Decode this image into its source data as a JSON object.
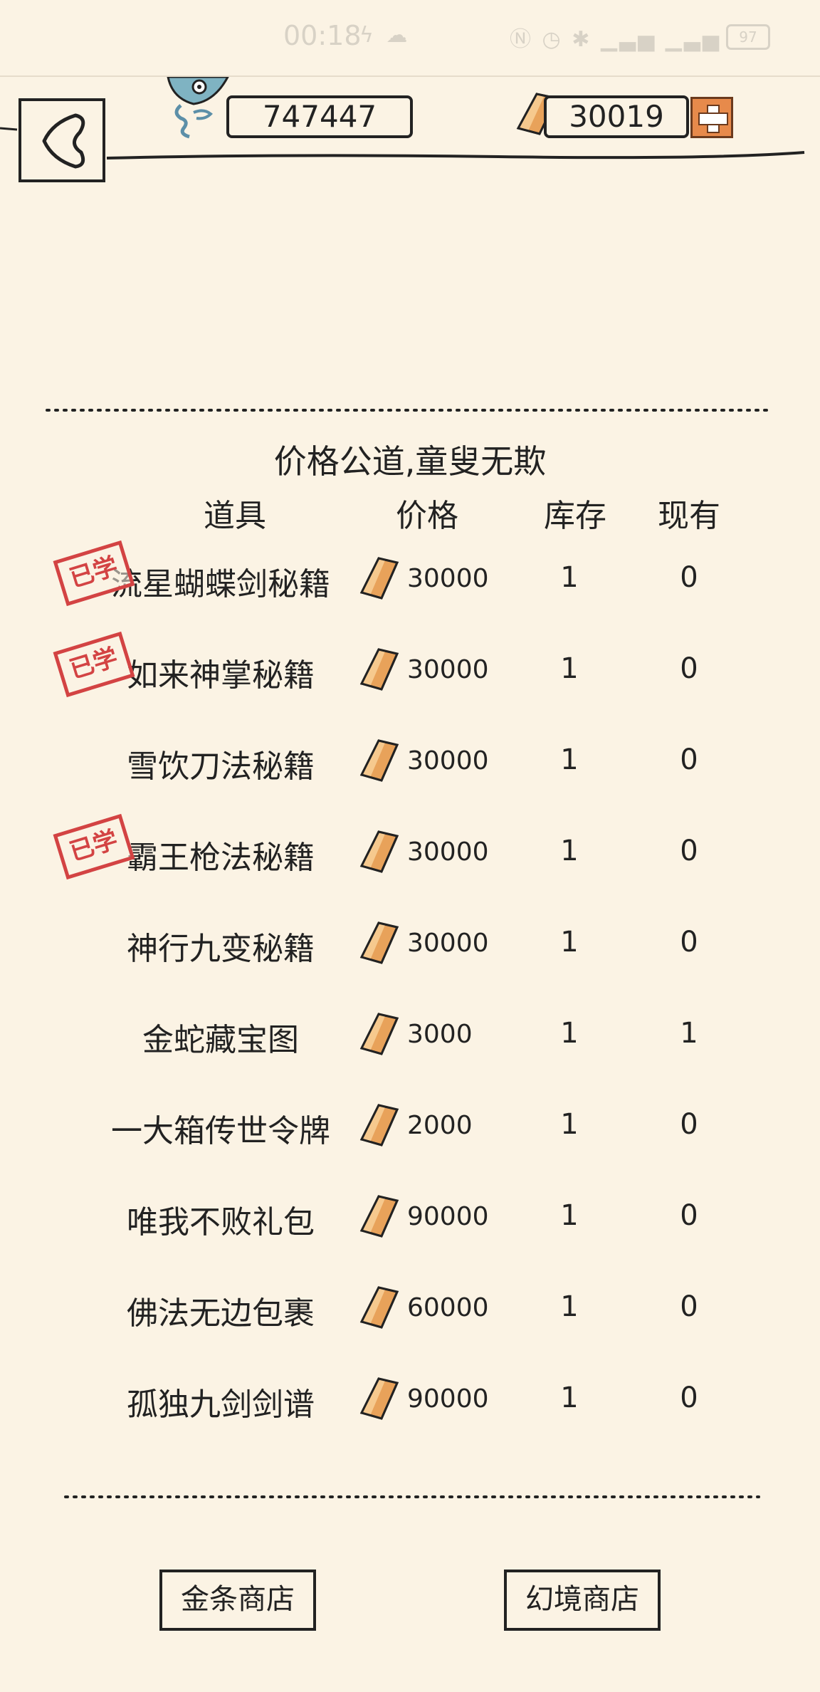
{
  "status_bar": {
    "time": "00:18",
    "battery": "97"
  },
  "header": {
    "coins": "747447",
    "gold": "30019"
  },
  "shop": {
    "slogan": "价格公道,童叟无欺",
    "columns": {
      "item": "道具",
      "price": "价格",
      "stock": "库存",
      "owned": "现有"
    },
    "stamp_text": "已学",
    "rows": [
      {
        "name": "流星蝴蝶剑秘籍",
        "price": "30000",
        "stock": "1",
        "owned": "0",
        "learned": true
      },
      {
        "name": "如来神掌秘籍",
        "price": "30000",
        "stock": "1",
        "owned": "0",
        "learned": true
      },
      {
        "name": "雪饮刀法秘籍",
        "price": "30000",
        "stock": "1",
        "owned": "0",
        "learned": false
      },
      {
        "name": "霸王枪法秘籍",
        "price": "30000",
        "stock": "1",
        "owned": "0",
        "learned": true
      },
      {
        "name": "神行九变秘籍",
        "price": "30000",
        "stock": "1",
        "owned": "0",
        "learned": false
      },
      {
        "name": "金蛇藏宝图",
        "price": "3000",
        "stock": "1",
        "owned": "1",
        "learned": false
      },
      {
        "name": "一大箱传世令牌",
        "price": "2000",
        "stock": "1",
        "owned": "0",
        "learned": false
      },
      {
        "name": "唯我不败礼包",
        "price": "90000",
        "stock": "1",
        "owned": "0",
        "learned": false
      },
      {
        "name": "佛法无边包裹",
        "price": "60000",
        "stock": "1",
        "owned": "0",
        "learned": false
      },
      {
        "name": "孤独九剑剑谱",
        "price": "90000",
        "stock": "1",
        "owned": "0",
        "learned": false
      }
    ]
  },
  "buttons": {
    "gold_shop": "金条商店",
    "illusion_shop": "幻境商店"
  },
  "colors": {
    "background": "#FBF3E4",
    "stamp": "#D34343",
    "gold": "#E8A25A",
    "plus_button": "#E78A4B"
  }
}
